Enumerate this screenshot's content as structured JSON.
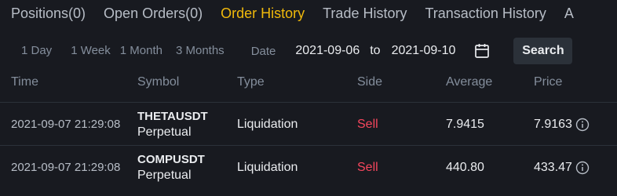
{
  "tabs": [
    {
      "label": "Positions(0)"
    },
    {
      "label": "Open Orders(0)"
    },
    {
      "label": "Order History"
    },
    {
      "label": "Trade History"
    },
    {
      "label": "Transaction History"
    },
    {
      "label": "A"
    }
  ],
  "active_tab": "Order History",
  "filters": {
    "ranges": [
      "1 Day",
      "1 Week",
      "1 Month",
      "3 Months"
    ],
    "date_label": "Date",
    "date_from": "2021-09-06",
    "to_label": "to",
    "date_to": "2021-09-10",
    "search_label": "Search"
  },
  "table": {
    "headers": {
      "time": "Time",
      "symbol": "Symbol",
      "type": "Type",
      "side": "Side",
      "average": "Average",
      "price": "Price"
    },
    "rows": [
      {
        "time": "2021-09-07 21:29:08",
        "symbol": "THETAUSDT",
        "contract": "Perpetual",
        "type": "Liquidation",
        "side": "Sell",
        "average": "7.9415",
        "price": "7.9163"
      },
      {
        "time": "2021-09-07 21:29:08",
        "symbol": "COMPUSDT",
        "contract": "Perpetual",
        "type": "Liquidation",
        "side": "Sell",
        "average": "440.80",
        "price": "433.47"
      }
    ]
  },
  "colors": {
    "background": "#181a20",
    "accent": "#f0b90b",
    "sell": "#f6465d",
    "muted": "#848e9c"
  },
  "icons": [
    "calendar-icon",
    "info-icon"
  ]
}
